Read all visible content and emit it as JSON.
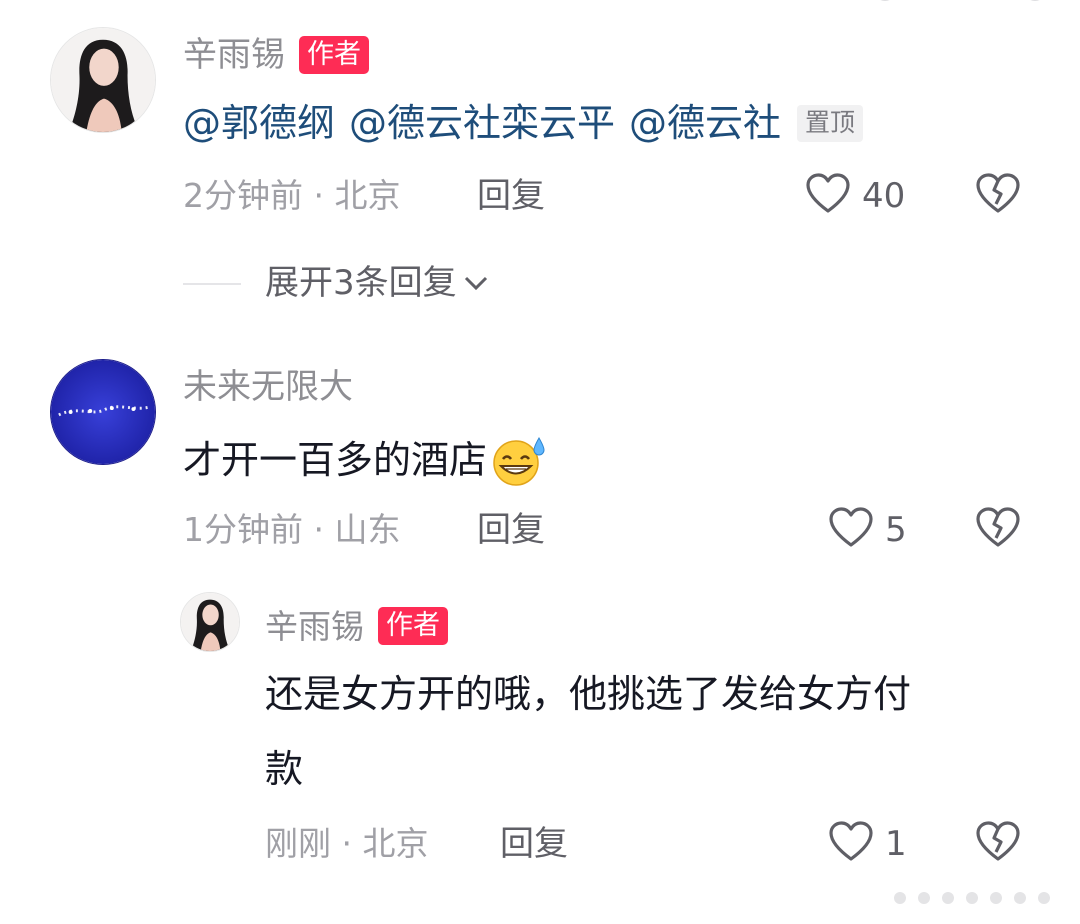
{
  "comments": [
    {
      "author": "辛雨锡",
      "badge": "作者",
      "mentions": [
        "@郭德纲",
        "@德云社栾云平",
        "@德云社"
      ],
      "pinned_label": "置顶",
      "time_location": "2分钟前 · 北京",
      "reply_label": "回复",
      "likes": "40",
      "expand_label": "展开3条回复"
    },
    {
      "author": "未来无限大",
      "text": "才开一百多的酒店",
      "emoji": "grinning-sweat-emoji",
      "time_location": "1分钟前 · 山东",
      "reply_label": "回复",
      "likes": "5"
    }
  ],
  "replies": [
    {
      "author": "辛雨锡",
      "badge": "作者",
      "text_line1": "还是女方开的哦，他挑选了发给女方付",
      "text_line2": "款",
      "time_location": "刚刚 · 北京",
      "reply_label": "回复",
      "likes": "1"
    }
  ],
  "colors": {
    "badge": "#fe2c55",
    "mention": "#1e4d7a",
    "meta": "#a0a0a6"
  }
}
